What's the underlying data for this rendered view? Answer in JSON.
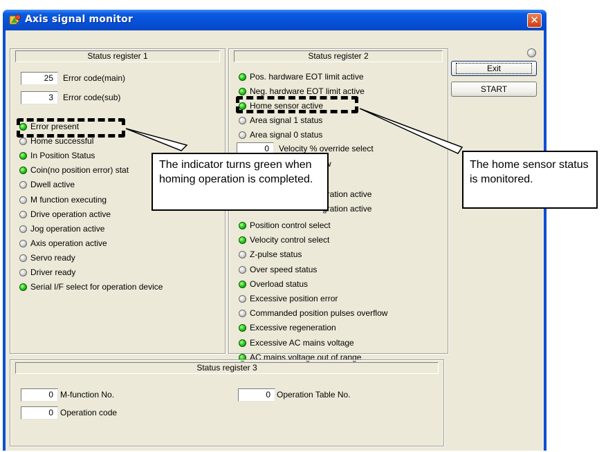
{
  "window": {
    "title": "Axis signal monitor",
    "close_symbol": "✕"
  },
  "status_register_1": {
    "title": "Status register 1",
    "fields": [
      {
        "value": "25",
        "label": "Error code(main)"
      },
      {
        "value": "3",
        "label": "Error code(sub)"
      }
    ],
    "indicators": [
      {
        "label": "Error present",
        "on": true
      },
      {
        "label": "Home successful",
        "on": false
      },
      {
        "label": "In Position Status",
        "on": true
      },
      {
        "label": "Coin(no position error) stat",
        "on": true
      },
      {
        "label": "Dwell active",
        "on": false
      },
      {
        "label": "M function executing",
        "on": false
      },
      {
        "label": "Drive operation active",
        "on": false
      },
      {
        "label": "Jog operation active",
        "on": false
      },
      {
        "label": "Axis operation active",
        "on": false
      },
      {
        "label": "Servo ready",
        "on": false
      },
      {
        "label": "Driver ready",
        "on": false
      },
      {
        "label": "Serial I/F select for operation device",
        "on": true
      }
    ]
  },
  "status_register_2": {
    "title": "Status register 2",
    "top_indicators": [
      {
        "label": "Pos. hardware EOT limit active",
        "on": true
      },
      {
        "label": "Neg. hardware EOT limit active",
        "on": true
      },
      {
        "label": "Home sensor active",
        "on": true
      },
      {
        "label": "Area signal 1 status",
        "on": false
      },
      {
        "label": "Area signal 0 status",
        "on": false
      }
    ],
    "override_field": {
      "value": "0",
      "label": "Velocity % override select"
    },
    "partial_labels": [
      "w",
      "gration active",
      "gration active"
    ],
    "bottom_indicators": [
      {
        "label": "Position control select",
        "on": true
      },
      {
        "label": "Velocity control select",
        "on": true
      },
      {
        "label": "Z-pulse status",
        "on": false
      },
      {
        "label": "Over speed status",
        "on": false
      },
      {
        "label": "Overload status",
        "on": true
      },
      {
        "label": "Excessive position error",
        "on": false
      },
      {
        "label": "Commanded position pulses overflow",
        "on": false
      },
      {
        "label": "Excessive regeneration",
        "on": true
      },
      {
        "label": "Excessive AC mains voltage",
        "on": true
      },
      {
        "label": "AC mains voltage out of range",
        "on": true
      }
    ]
  },
  "status_register_3": {
    "title": "Status register 3",
    "fields": [
      {
        "value": "0",
        "label": "M-function No."
      },
      {
        "value": "0",
        "label": "Operation code"
      },
      {
        "value": "0",
        "label": "Operation Table No."
      }
    ]
  },
  "buttons": {
    "exit": "Exit",
    "start": "START"
  },
  "status_lamp": {
    "on": false
  },
  "callouts": {
    "home_successful": "The indicator turns green when homing operation is completed.",
    "home_sensor": "The home sensor status is monitored."
  }
}
